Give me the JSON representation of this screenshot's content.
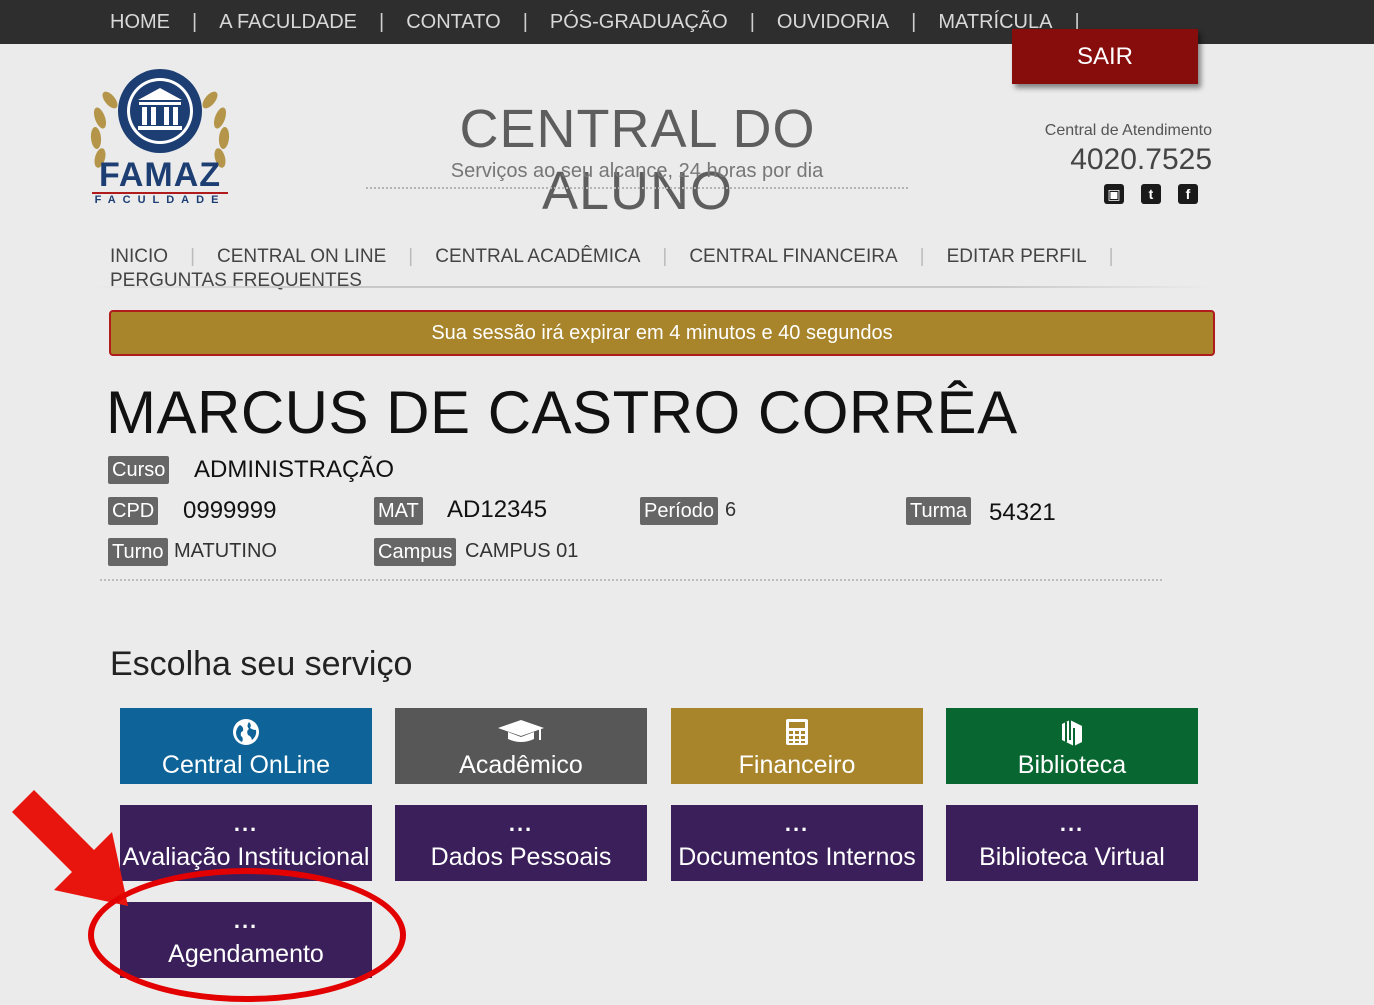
{
  "topnav": {
    "items": [
      "HOME",
      "A FACULDADE",
      "CONTATO",
      "PÓS-GRADUAÇÃO",
      "OUVIDORIA",
      "MATRÍCULA"
    ],
    "separator": "|",
    "logout": "SAIR"
  },
  "logo": {
    "name": "FAMAZ",
    "sub": "FACULDADE",
    "icon": "building-columns-icon"
  },
  "header": {
    "title": "CENTRAL DO ALUNO",
    "subtitle": "Serviços ao seu alcance, 24 horas por dia",
    "support_label": "Central de Atendimento",
    "support_phone": "4020.7525",
    "social": [
      "youtube-icon",
      "twitter-icon",
      "facebook-icon"
    ]
  },
  "subnav": {
    "row1": [
      "INICIO",
      "CENTRAL ON LINE",
      "CENTRAL ACADÊMICA",
      "CENTRAL FINANCEIRA",
      "EDITAR PERFIL"
    ],
    "row2": [
      "PERGUNTAS FREQUENTES"
    ],
    "separator": "|"
  },
  "session": {
    "message": "Sua sessão irá expirar em 4 minutos e 40 segundos"
  },
  "student": {
    "name": "MARCUS DE CASTRO CORRÊA",
    "curso_label": "Curso",
    "curso": "ADMINISTRAÇÃO",
    "cpd_label": "CPD",
    "cpd": "0999999",
    "mat_label": "MAT",
    "mat": "AD12345",
    "periodo_label": "Período",
    "periodo": "6",
    "turma_label": "Turma",
    "turma": "54321",
    "turno_label": "Turno",
    "turno": "MATUTINO",
    "campus_label": "Campus",
    "campus": "CAMPUS 01"
  },
  "services": {
    "title": "Escolha seu serviço",
    "dots": "...",
    "tiles": [
      {
        "label": "Central OnLine",
        "icon": "globe-icon",
        "color": "#0e6499"
      },
      {
        "label": "Acadêmico",
        "icon": "graduation-cap-icon",
        "color": "#575757"
      },
      {
        "label": "Financeiro",
        "icon": "calculator-icon",
        "color": "#a8852a"
      },
      {
        "label": "Biblioteca",
        "icon": "books-icon",
        "color": "#086630"
      },
      {
        "label": "Avaliação Institucional",
        "icon": "dots-icon",
        "color": "#3b1f5b"
      },
      {
        "label": "Dados Pessoais",
        "icon": "dots-icon",
        "color": "#3b1f5b"
      },
      {
        "label": "Documentos Internos",
        "icon": "dots-icon",
        "color": "#3b1f5b"
      },
      {
        "label": "Biblioteca Virtual",
        "icon": "dots-icon",
        "color": "#3b1f5b"
      },
      {
        "label": "Agendamento",
        "icon": "dots-icon",
        "color": "#3b1f5b"
      }
    ]
  },
  "annotation": {
    "highlight_color": "#e30000"
  }
}
